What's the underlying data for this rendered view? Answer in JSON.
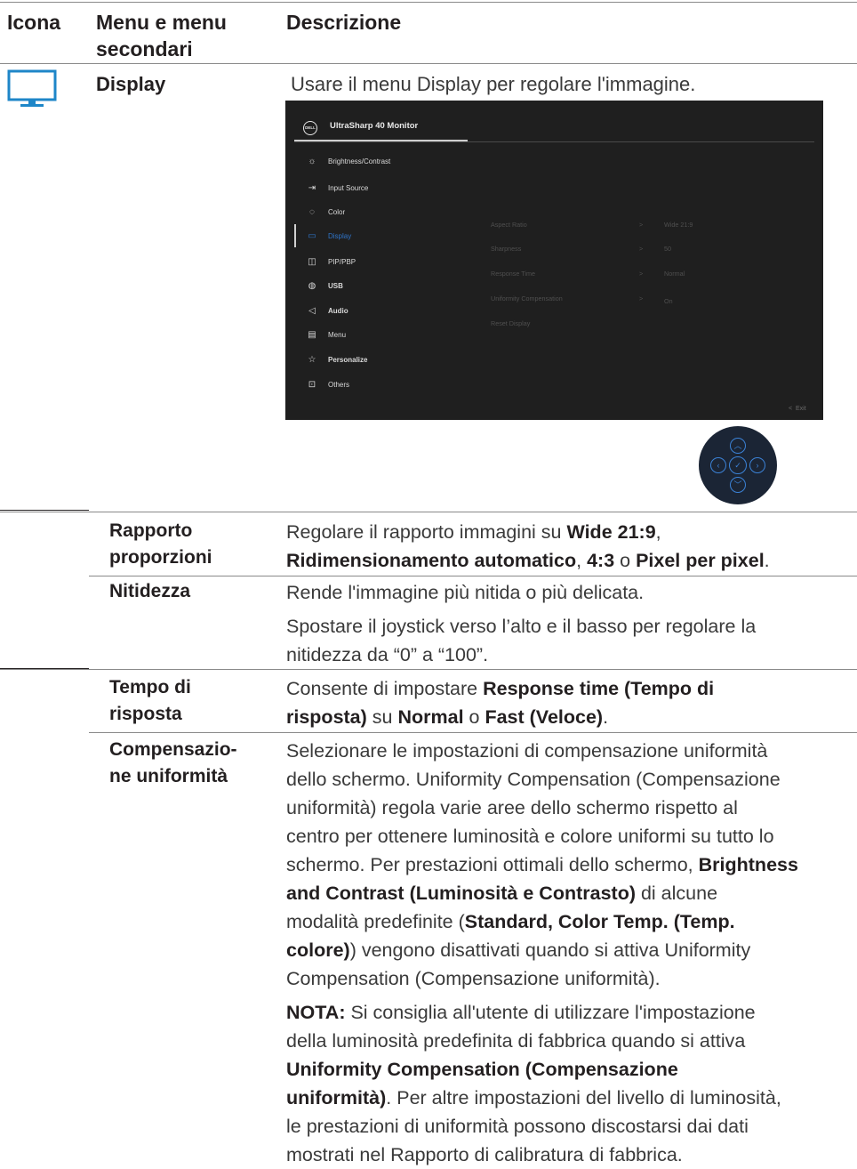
{
  "header": {
    "icon_col": "Icona",
    "menu_col": "Menu e menu secondari",
    "desc_col": "Descrizione"
  },
  "display_row": {
    "label": "Display",
    "description": "Usare il menu Display per regolare l'immagine."
  },
  "osd": {
    "logo": "DELL",
    "title": "UltraSharp 40 Monitor",
    "menu_items": [
      {
        "label": "Brightness/Contrast",
        "icon": "sun-icon"
      },
      {
        "label": "Input Source",
        "icon": "input-icon"
      },
      {
        "label": "Color",
        "icon": "palette-icon"
      },
      {
        "label": "Display",
        "icon": "monitor-icon",
        "active": true
      },
      {
        "label": "PIP/PBP",
        "icon": "pip-icon"
      },
      {
        "label": "USB",
        "icon": "mouse-icon"
      },
      {
        "label": "Audio",
        "icon": "speaker-icon"
      },
      {
        "label": "Menu",
        "icon": "menu-icon"
      },
      {
        "label": "Personalize",
        "icon": "star-icon"
      },
      {
        "label": "Others",
        "icon": "others-icon"
      }
    ],
    "submenu": [
      {
        "label": "Aspect Ratio",
        "chevron": ">",
        "value": "Wide 21:9"
      },
      {
        "label": "Sharpness",
        "chevron": ">",
        "value": "50"
      },
      {
        "label": "Response Time",
        "chevron": ">",
        "value": "Normal"
      },
      {
        "label": "Uniformity Compensation",
        "chevron": ">",
        "value": "On"
      },
      {
        "label": "Reset Display",
        "chevron": "",
        "value": ""
      }
    ],
    "exit": "Exit",
    "accent_color": "#2f74c8"
  },
  "joystick": {
    "up": "︿",
    "down": "﹀",
    "left": "‹",
    "right": "›",
    "center": "✓"
  },
  "rows": [
    {
      "label": [
        "Rapporto",
        "proporzioni"
      ],
      "lines": [
        [
          "Regolare il rapporto immagini su ",
          {
            "b": "Wide 21:9"
          },
          ","
        ],
        [
          {
            "b": "Ridimensionamento automatico"
          },
          ", ",
          {
            "b": "4:3"
          },
          " o ",
          {
            "b": "Pixel per pixel"
          },
          "."
        ]
      ]
    },
    {
      "label": [
        "Nitidezza"
      ],
      "lines": [
        [
          "Rende l'immagine più nitida o più delicata."
        ]
      ],
      "lines2": [
        [
          "Spostare il joystick verso l’alto e il basso per regolare la"
        ],
        [
          "nitidezza da “0” a “100”."
        ]
      ]
    },
    {
      "label": [
        "Tempo di",
        "risposta"
      ],
      "lines": [
        [
          "Consente di impostare ",
          {
            "b": "Response time (Tempo di"
          }
        ],
        [
          {
            "b": "risposta)"
          },
          " su ",
          {
            "b": "Normal"
          },
          " o ",
          {
            "b": "Fast (Veloce)"
          },
          "."
        ]
      ]
    },
    {
      "label": [
        "Compensazio-",
        "ne uniformità"
      ],
      "lines": [
        [
          "Selezionare le impostazioni di compensazione uniformità"
        ],
        [
          "dello schermo. Uniformity Compensation (Compensazione"
        ],
        [
          "uniformità) regola varie aree dello schermo rispetto al"
        ],
        [
          "centro per ottenere luminosità e colore uniformi su tutto lo"
        ],
        [
          "schermo. Per prestazioni ottimali dello schermo, ",
          {
            "b": "Brightness"
          }
        ],
        [
          {
            "b": "and Contrast (Luminosità e Contrasto)"
          },
          " di alcune"
        ],
        [
          "modalità predefinite (",
          {
            "b": "Standard, Color Temp. (Temp."
          }
        ],
        [
          {
            "b": "colore)"
          },
          ") vengono disattivati quando si attiva Uniformity"
        ],
        [
          "Compensation (Compensazione uniformità)."
        ]
      ],
      "lines2": [
        [
          {
            "b": "NOTA:"
          },
          " Si consiglia all'utente di utilizzare l'impostazione"
        ],
        [
          "della luminosità predefinita di fabbrica quando si attiva"
        ],
        [
          {
            "b": "Uniformity Compensation (Compensazione"
          }
        ],
        [
          {
            "b": "uniformità)"
          },
          ". Per altre impostazioni del livello di luminosità,"
        ],
        [
          "le prestazioni di uniformità possono discostarsi dai dati"
        ],
        [
          "mostrati nel Rapporto di calibratura di fabbrica."
        ]
      ]
    }
  ]
}
